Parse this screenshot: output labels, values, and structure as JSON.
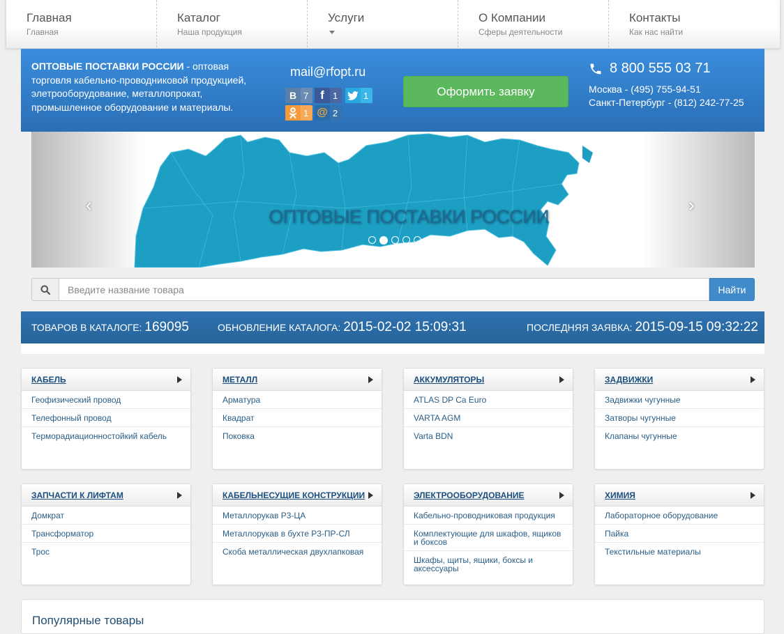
{
  "nav": [
    {
      "title": "Главная",
      "sub": "Главная"
    },
    {
      "title": "Каталог",
      "sub": "Наша продукция"
    },
    {
      "title": "Услуги",
      "sub": ""
    },
    {
      "title": "О Компании",
      "sub": "Сферы деятельности"
    },
    {
      "title": "Контакты",
      "sub": "Как нас найти"
    }
  ],
  "header": {
    "desc_bold": "ОПТОВЫЕ ПОСТАВКИ РОССИИ",
    "desc_rest": " - оптовая торговля кабельно-проводниковой продукцией, элетрооборудование, металлопрокат, промышленное оборудование и материалы.",
    "email": "mail@rfopt.ru",
    "order_button": "Оформить заявку",
    "phone_main": "8 800 555 03 71",
    "phone_moscow": "Москва - (495) 755-94-51",
    "phone_spb": "Санкт-Петербург - (812) 242-77-25"
  },
  "social": [
    {
      "icon": "vk-icon",
      "glyph": "B",
      "count": "7",
      "color": "#5b7fa6"
    },
    {
      "icon": "facebook-icon",
      "glyph": "f",
      "count": "1",
      "color": "#3b5998"
    },
    {
      "icon": "twitter-icon",
      "glyph": "t",
      "count": "1",
      "color": "#2aa9e0"
    },
    {
      "icon": "odnoklassniki-icon",
      "glyph": "ok",
      "count": "1",
      "color": "#f59a3b"
    },
    {
      "icon": "mailru-icon",
      "glyph": "@",
      "count": "2",
      "color": "#2a6ca8"
    }
  ],
  "slider": {
    "caption": "ОПТОВЫЕ ПОСТАВКИ РОССИИ",
    "dots": 5,
    "active_dot": 2
  },
  "search": {
    "placeholder": "Введите название товара",
    "button": "Найти"
  },
  "stats": {
    "products_label": "ТОВАРОВ В КАТАЛОГЕ:",
    "products_value": "169095",
    "update_label": "ОБНОВЛЕНИЕ КАТАЛОГА:",
    "update_value": "2015-02-02 15:09:31",
    "last_label": "ПОСЛЕДНЯЯ ЗАЯВКА:",
    "last_value": "2015-09-15 09:32:22"
  },
  "categories": [
    {
      "title": "КАБЕЛЬ",
      "items": [
        "Геофизический провод",
        "Телефонный провод",
        "Терморадиационностойкий кабель"
      ]
    },
    {
      "title": "МЕТАЛЛ",
      "items": [
        "Арматура",
        "Квадрат",
        "Поковка"
      ]
    },
    {
      "title": "АККУМУЛЯТОРЫ",
      "items": [
        "ATLAS DP Ca Euro",
        "VARTA AGM",
        "Varta BDN"
      ]
    },
    {
      "title": "ЗАДВИЖКИ",
      "items": [
        "Задвижки чугунные",
        "Затворы чугунные",
        "Клапаны чугунные"
      ]
    },
    {
      "title": "ЗАПЧАСТИ К ЛИФТАМ",
      "items": [
        "Домкрат",
        "Трансформатор",
        "Трос"
      ]
    },
    {
      "title": "КАБЕЛЬНЕСУЩИЕ КОНСТРУКЦИИ",
      "items": [
        "Металлорукав Р3-ЦА",
        "Металлорукав в бухте Р3-ПР-СЛ",
        "Скоба металлическая двухлапковая"
      ]
    },
    {
      "title": "ЭЛЕКТРООБОРУДОВАНИЕ",
      "items": [
        "Кабельно-проводниковая продукция",
        "Комплектующие для шкафов, ящиков и боксов",
        "Шкафы, щиты, ящики, боксы и аксессуары"
      ]
    },
    {
      "title": "ХИМИЯ",
      "items": [
        "Лабораторное оборудование",
        "Пайка",
        "Текстильные материалы"
      ]
    }
  ],
  "popular": {
    "title": "Популярные товары"
  }
}
